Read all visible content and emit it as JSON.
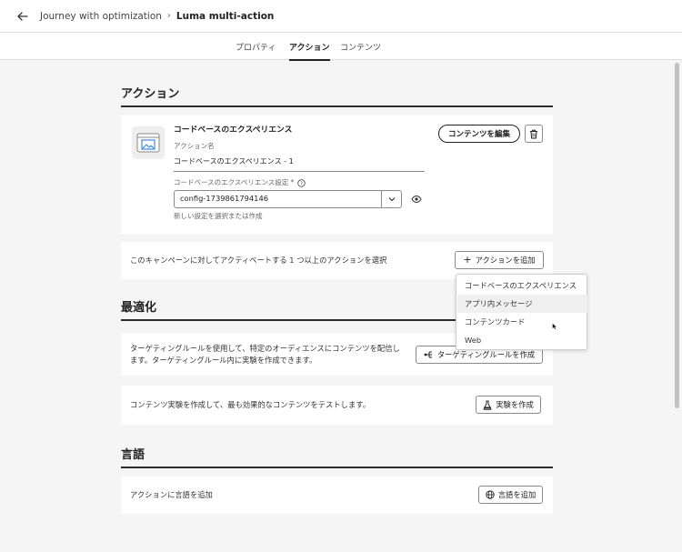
{
  "header": {
    "breadcrumb_parent": "Journey with optimization",
    "breadcrumb_sep": "›",
    "breadcrumb_current": "Luma multi-action"
  },
  "tabs": [
    {
      "label": "プロパティ"
    },
    {
      "label": "アクション"
    },
    {
      "label": "コンテンツ"
    }
  ],
  "actions": {
    "title": "アクション",
    "card": {
      "title": "コードベースのエクスペリエンス",
      "name_label": "アクション名",
      "name_value": "コードベースのエクスペリエンス - 1",
      "config_label": "コードベースのエクスペリエンス設定 *",
      "config_value": "config-1739861794146",
      "config_help": "新しい設定を選択または作成",
      "edit_button": "コンテンツを編集"
    },
    "select_text": "このキャンペーンに対してアクティベートする 1 つ以上のアクションを選択",
    "add_button": "アクションを追加",
    "add_menu": [
      {
        "label": "コードベースのエクスペリエンス"
      },
      {
        "label": "アプリ内メッセージ"
      },
      {
        "label": "コンテンツカード"
      },
      {
        "label": "Web"
      }
    ]
  },
  "optimization": {
    "title": "最適化",
    "targeting_text_1": "ターゲティングルールを使用して、特定のオーディエンスにコンテンツを配信し",
    "targeting_text_2": "ます。ターゲティングルール内に実験を作成できます。",
    "targeting_button": "ターゲティングルールを作成",
    "experiment_text": "コンテンツ実験を作成して、最も効果的なコンテンツをテストします。",
    "experiment_button": "実験を作成"
  },
  "language": {
    "title": "言語",
    "text": "アクションに言語を追加",
    "button": "言語を追加"
  }
}
